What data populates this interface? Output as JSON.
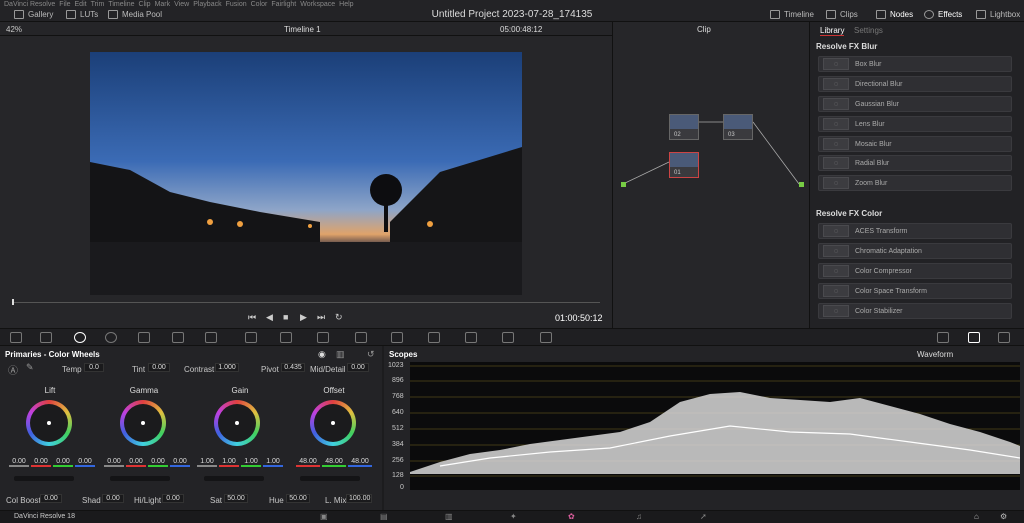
{
  "topbar": {
    "left_items": [
      "DaVinci Resolve",
      "File",
      "Edit",
      "Trim",
      "Timeline",
      "Clip",
      "Mark",
      "View",
      "Playback",
      "Fusion",
      "Color",
      "Fairlight",
      "Workspace",
      "Help"
    ],
    "title": "Untitled Project 2023-07-28_174135",
    "gallery": "Gallery",
    "luts": "LUTs",
    "media_pool": "Media Pool",
    "timeline": "Timeline",
    "clips": "Clips",
    "nodes": "Nodes",
    "effects": "Effects",
    "lightbox": "Lightbox"
  },
  "viewer": {
    "zoom": "42%",
    "timeline_name": "Timeline 1",
    "timecode_top": "05:00:48:12",
    "clip": "Clip",
    "timecode": "01:00:50:12"
  },
  "nodes": [
    {
      "label": "02"
    },
    {
      "label": "03"
    },
    {
      "label": "01"
    }
  ],
  "library": {
    "tab_library": "Library",
    "tab_settings": "Settings",
    "blur_title": "Resolve FX Blur",
    "blur_items": [
      "Box Blur",
      "Directional Blur",
      "Gaussian Blur",
      "Lens Blur",
      "Mosaic Blur",
      "Radial Blur",
      "Zoom Blur"
    ],
    "color_title": "Resolve FX Color",
    "color_items": [
      "ACES Transform",
      "Chromatic Adaptation",
      "Color Compressor",
      "Color Space Transform",
      "Color Stabilizer"
    ]
  },
  "primaries": {
    "title": "Primaries - Color Wheels",
    "temp_label": "Temp",
    "temp": "0.0",
    "tint_label": "Tint",
    "tint": "0.00",
    "contrast_label": "Contrast",
    "contrast": "1.000",
    "pivot_label": "Pivot",
    "pivot": "0.435",
    "middetail_label": "Mid/Detail",
    "middetail": "0.00",
    "wheels": [
      {
        "name": "Lift",
        "values": [
          "0.00",
          "0.00",
          "0.00",
          "0.00"
        ]
      },
      {
        "name": "Gamma",
        "values": [
          "0.00",
          "0.00",
          "0.00",
          "0.00"
        ]
      },
      {
        "name": "Gain",
        "values": [
          "1.00",
          "1.00",
          "1.00",
          "1.00"
        ]
      },
      {
        "name": "Offset",
        "values": [
          "48.00",
          "48.00",
          "48.00"
        ]
      }
    ],
    "colboost_label": "Col Boost",
    "colboost": "0.00",
    "shad_label": "Shad",
    "shad": "0.00",
    "hilight_label": "Hi/Light",
    "hilight": "0.00",
    "sat_label": "Sat",
    "sat": "50.00",
    "hue_label": "Hue",
    "hue": "50.00",
    "lmix_label": "L. Mix",
    "lmix": "100.00"
  },
  "scopes": {
    "title": "Scopes",
    "mode": "Waveform",
    "ticks": [
      "1023",
      "896",
      "768",
      "640",
      "512",
      "384",
      "256",
      "128",
      "0"
    ]
  },
  "bottom": {
    "app": "DaVinci Resolve 18"
  }
}
